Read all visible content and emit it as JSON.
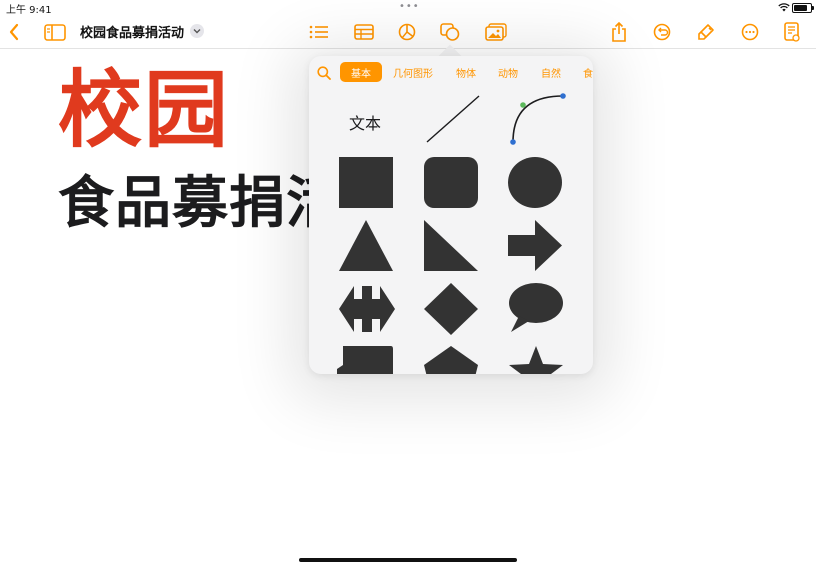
{
  "status_bar": {
    "time": "上午 9:41",
    "dots": "•••"
  },
  "toolbar": {
    "document_title": "校园食品募捐活动",
    "icons": [
      "back-chevron",
      "sidebar",
      "list",
      "table",
      "chart",
      "shapes",
      "media",
      "share",
      "undo",
      "brush",
      "more",
      "document-setup"
    ],
    "accent": "#ff9500"
  },
  "document": {
    "heading_line1": "校园",
    "heading_line2": "食品募捐活",
    "heading_color": "#e03a1e"
  },
  "shapes_popover": {
    "tabs": [
      {
        "label": "基本",
        "active": true
      },
      {
        "label": "几何图形",
        "active": false
      },
      {
        "label": "物体",
        "active": false
      },
      {
        "label": "动物",
        "active": false
      },
      {
        "label": "自然",
        "active": false
      },
      {
        "label": "食",
        "active": false
      }
    ],
    "text_item": "文本",
    "shapes": [
      "text",
      "line",
      "curve",
      "square",
      "rounded-rectangle",
      "circle",
      "triangle",
      "right-triangle",
      "arrow",
      "double-arrow",
      "diamond",
      "speech-bubble",
      "callout",
      "pentagon",
      "star"
    ],
    "shape_color": "#333333"
  }
}
